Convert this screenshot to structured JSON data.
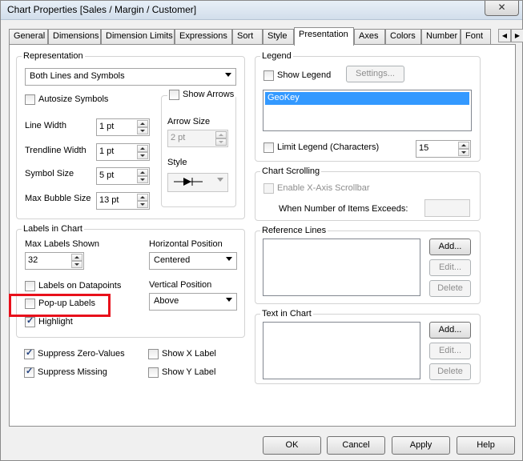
{
  "window": {
    "title": "Chart Properties [Sales / Margin / Customer]",
    "close_symbol": "✕"
  },
  "tabs": [
    {
      "label": "General"
    },
    {
      "label": "Dimensions"
    },
    {
      "label": "Dimension Limits"
    },
    {
      "label": "Expressions"
    },
    {
      "label": "Sort"
    },
    {
      "label": "Style"
    },
    {
      "label": "Presentation"
    },
    {
      "label": "Axes"
    },
    {
      "label": "Colors"
    },
    {
      "label": "Number"
    },
    {
      "label": "Font"
    }
  ],
  "tab_arrows": {
    "left": "◀",
    "right": "▶"
  },
  "representation": {
    "title": "Representation",
    "mode": "Both Lines and Symbols",
    "autosize_symbols": "Autosize Symbols",
    "line_width_label": "Line Width",
    "line_width": "1 pt",
    "trendline_width_label": "Trendline Width",
    "trendline_width": "1 pt",
    "symbol_size_label": "Symbol Size",
    "symbol_size": "5 pt",
    "max_bubble_label": "Max Bubble Size",
    "max_bubble": "13 pt",
    "show_arrows": "Show Arrows",
    "arrow_size_label": "Arrow Size",
    "arrow_size": "2 pt",
    "style_label": "Style"
  },
  "labels_in_chart": {
    "title": "Labels in Chart",
    "max_labels_label": "Max Labels Shown",
    "max_labels": "32",
    "horizontal_position_label": "Horizontal Position",
    "horizontal_position": "Centered",
    "vertical_position_label": "Vertical Position",
    "vertical_position": "Above",
    "labels_on_datapoints": "Labels on Datapoints",
    "popup_labels": "Pop-up Labels",
    "highlight": "Highlight"
  },
  "bottom_options": {
    "suppress_zero": "Suppress Zero-Values",
    "suppress_missing": "Suppress Missing",
    "show_x_label": "Show X Label",
    "show_y_label": "Show Y Label"
  },
  "legend": {
    "title": "Legend",
    "show_legend": "Show Legend",
    "settings_button": "Settings...",
    "items": [
      "GeoKey"
    ],
    "limit_legend": "Limit Legend (Characters)",
    "limit_value": "15"
  },
  "chart_scrolling": {
    "title": "Chart Scrolling",
    "enable_scrollbar": "Enable X-Axis Scrollbar",
    "when_exceeds": "When Number of Items Exceeds:"
  },
  "reference_lines": {
    "title": "Reference Lines",
    "add": "Add...",
    "edit": "Edit...",
    "delete": "Delete"
  },
  "text_in_chart": {
    "title": "Text in Chart",
    "add": "Add...",
    "edit": "Edit...",
    "delete": "Delete"
  },
  "footer": {
    "ok": "OK",
    "cancel": "Cancel",
    "apply": "Apply",
    "help": "Help"
  },
  "colors": {
    "selection": "#3399ff",
    "highlight_annotation": "#e8101b"
  }
}
